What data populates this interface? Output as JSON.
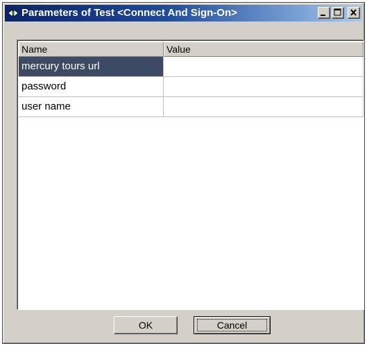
{
  "window": {
    "title": "Parameters of Test <Connect And Sign-On>",
    "title_icon": "parameters-icon",
    "controls": [
      "minimize-icon",
      "maximize-icon",
      "close-icon"
    ]
  },
  "table": {
    "columns": [
      "Name",
      "Value"
    ],
    "rows": [
      {
        "name": "mercury tours url",
        "value": "",
        "selected": true
      },
      {
        "name": "password",
        "value": "",
        "selected": false
      },
      {
        "name": "user name",
        "value": "",
        "selected": false
      }
    ]
  },
  "buttons": {
    "ok_label": "OK",
    "cancel_label": "Cancel"
  },
  "colors": {
    "title_gradient_start": "#0a246a",
    "title_gradient_end": "#a6caf0",
    "face": "#d4d0c8",
    "selection": "#3c4a63"
  }
}
